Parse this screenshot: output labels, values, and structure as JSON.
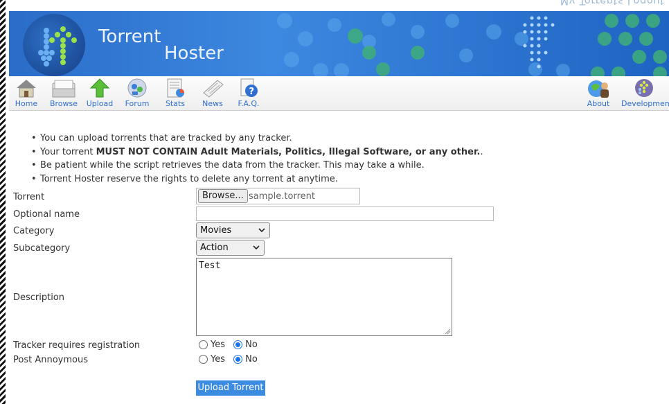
{
  "header": {
    "mirror_text": "My Torrents  Logout",
    "brand_line1": "Torrent",
    "brand_line2": "Hoster"
  },
  "toolbar": {
    "items": [
      {
        "label": "Home",
        "icon": "home-icon"
      },
      {
        "label": "Browse",
        "icon": "browse-icon"
      },
      {
        "label": "Upload",
        "icon": "upload-icon"
      },
      {
        "label": "Forum",
        "icon": "forum-icon"
      },
      {
        "label": "Stats",
        "icon": "stats-icon"
      },
      {
        "label": "News",
        "icon": "news-icon"
      },
      {
        "label": "F.A.Q.",
        "icon": "faq-icon"
      },
      {
        "label": "About",
        "icon": "about-icon"
      },
      {
        "label": "Development",
        "icon": "development-icon"
      }
    ]
  },
  "notes": {
    "item1": "You can upload torrents that are tracked by any tracker.",
    "item2_prefix": "Your torrent ",
    "item2_bold": "MUST NOT CONTAIN Adult Materials, Politics, Illegal Software, or any other.",
    "item2_suffix": ".",
    "item3": "Be patient while the script retrieves the data from the tracker. This may take a while.",
    "item4": "Torrent Hoster reserve the rights to delete any torrent at anytime."
  },
  "form": {
    "torrent_label": "Torrent",
    "browse_label": "Browse...",
    "file_name": "sample.torrent",
    "optional_name_label": "Optional name",
    "optional_name_value": "",
    "category_label": "Category",
    "category_value": "Movies",
    "subcategory_label": "Subcategory",
    "subcategory_value": "Action",
    "description_label": "Description",
    "description_value": "Test",
    "tracker_reg_label": "Tracker requires registration",
    "post_anon_label": "Post Annoymous",
    "yes": "Yes",
    "no": "No",
    "tracker_reg_selected": "No",
    "post_anon_selected": "No",
    "submit_label": "Upload Torrent"
  },
  "colors": {
    "banner": "#3d88e0",
    "link": "#2f6fd0",
    "button": "#3b8be0",
    "radio": "#1a73e8"
  }
}
